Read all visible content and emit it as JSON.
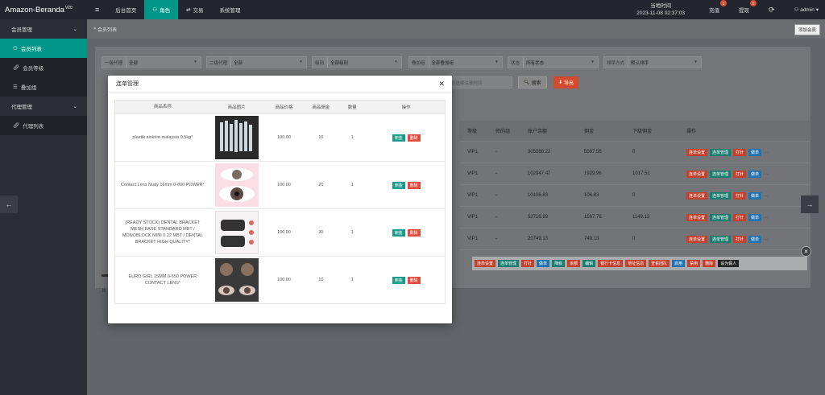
{
  "app": {
    "title": "Amazon-Beranda",
    "version": "V20"
  },
  "topnav": {
    "menu_icon": "≡",
    "items": [
      {
        "label": "后台首页",
        "icon": ""
      },
      {
        "label": "角色",
        "icon": "user-icon"
      },
      {
        "label": "交易",
        "icon": "exchange-icon"
      },
      {
        "label": "系统管理",
        "icon": ""
      }
    ]
  },
  "topright": {
    "clock_label": "当地时间",
    "clock_value": "2023-11-08 02:37:03",
    "recharge": "充值",
    "recharge_badge": "3",
    "withdraw": "提现",
    "withdraw_badge": "0",
    "refresh_icon": "⟳",
    "user": "admin",
    "user_icon": "user-icon"
  },
  "sidebar": {
    "groups": [
      {
        "label": "会员管理",
        "items": [
          "会员列表",
          "会员等级",
          "叠加组"
        ]
      },
      {
        "label": "代理管理",
        "items": [
          "代理列表"
        ]
      }
    ]
  },
  "breadcrumb": {
    "text": "会员列表",
    "add_button": "添加会员"
  },
  "filters": [
    {
      "label": "一级代理",
      "value": "全部"
    },
    {
      "label": "二级代理",
      "value": "全部"
    },
    {
      "label": "级别",
      "value": "全部级别"
    },
    {
      "label": "叠加组",
      "value": "全部叠加组"
    },
    {
      "label": "状态",
      "value": "所有状态"
    },
    {
      "label": "排序方式",
      "value": "默认排序"
    }
  ],
  "date_placeholder": "请选择注册时间",
  "search_label": "搜索",
  "export_label": "导出",
  "grid": {
    "headers": [
      "等级",
      "师的组",
      "账户余额",
      "佣金",
      "下级佣金",
      "操作"
    ],
    "rows": [
      [
        "VIP1",
        "-",
        "305088.22",
        "5087.56",
        "0"
      ],
      [
        "VIP1",
        "-",
        "102947.47",
        "1929.96",
        "1017.51"
      ],
      [
        "VIP1",
        "-",
        "10106.83",
        "106.83",
        "0"
      ],
      [
        "VIP1",
        "-",
        "52716.89",
        "1567.76",
        "1149.13"
      ],
      [
        "VIP1",
        "-",
        "20749.13",
        "749.13",
        "0"
      ]
    ],
    "ops": [
      "连单设置",
      "连单管理",
      "打针",
      "做单",
      "..."
    ]
  },
  "bar2": [
    "连单设置",
    "连单管理",
    "打针",
    "做单",
    "降级",
    "余额",
    "编辑",
    "银行卡信息",
    "地址信息",
    "查看团队",
    "启用",
    "禁用",
    "删除",
    "设为假人"
  ],
  "total_text": "共",
  "modal": {
    "title": "连单管理",
    "close": "✕",
    "headers": [
      "商品名称",
      "商品图片",
      "商品价格",
      "商品佣金",
      "数量",
      "操作"
    ],
    "rows": [
      {
        "name": "plastik aiskrim malaysia 0.5kg*",
        "price": "100.00",
        "commission": "10",
        "qty": "1"
      },
      {
        "name": "Contact Lens Nudy 16mm 0-800 POWER*",
        "price": "100.00",
        "commission": "20",
        "qty": "1"
      },
      {
        "name": "(READY STOCK) DENTAL BRACKET MESH BASE STANDARD MBT / MONOBLOCK MINI 0.22 MBT / DENTAL BRACKET HIGH QUALITY*",
        "price": "100.00",
        "commission": "30",
        "qty": "1"
      },
      {
        "name": "EURO GIRL 15MM 0-650 POWER CONTACT LENS*",
        "price": "100.00",
        "commission": "10",
        "qty": "1"
      }
    ],
    "btn_save": "佣金",
    "btn_delete": "删除"
  },
  "nav_arrows": {
    "left": "←",
    "right": "→"
  }
}
